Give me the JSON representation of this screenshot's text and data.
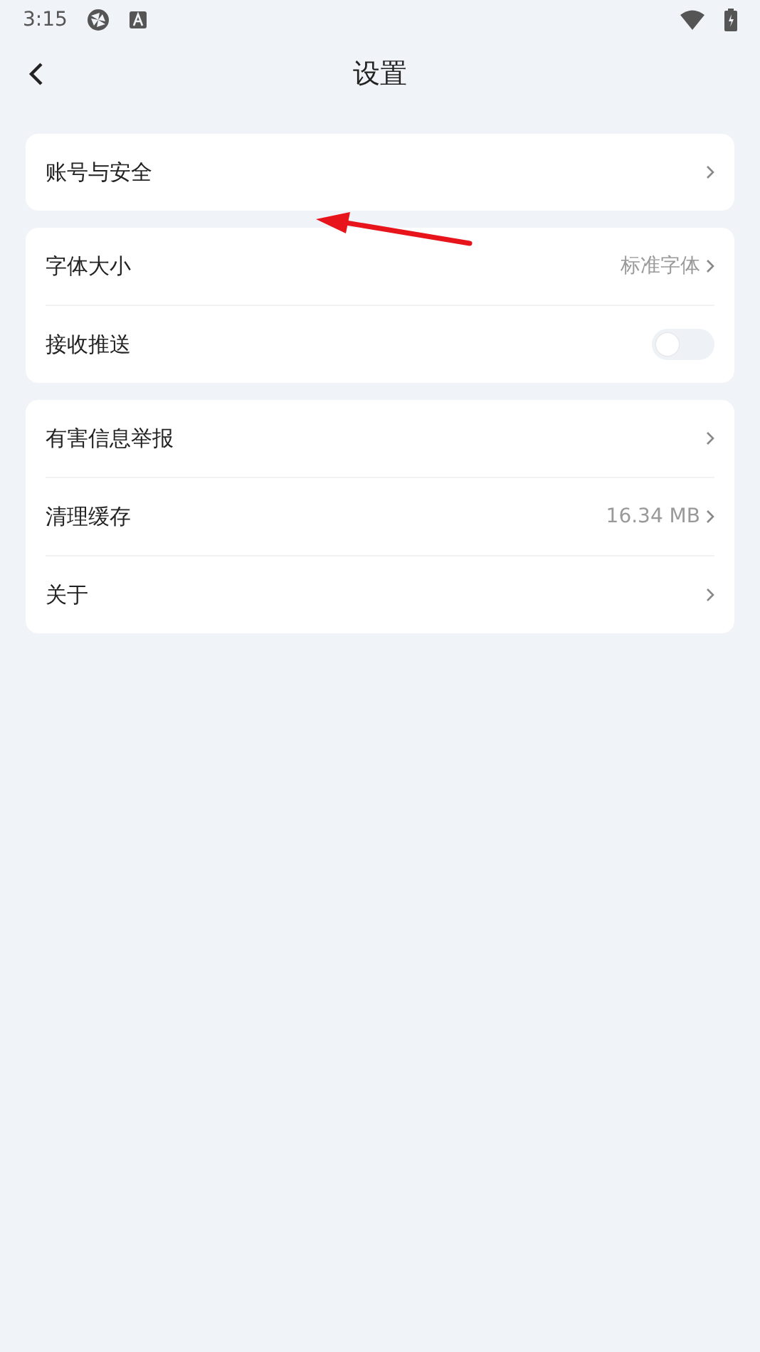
{
  "status_bar": {
    "time": "3:15"
  },
  "header": {
    "title": "设置"
  },
  "groups": [
    {
      "rows": [
        {
          "kind": "link",
          "label": "账号与安全"
        }
      ]
    },
    {
      "rows": [
        {
          "kind": "link",
          "label": "字体大小",
          "value": "标准字体"
        },
        {
          "kind": "toggle",
          "label": "接收推送",
          "on": false
        }
      ]
    },
    {
      "rows": [
        {
          "kind": "link",
          "label": "有害信息举报"
        },
        {
          "kind": "link",
          "label": "清理缓存",
          "value": "16.34 MB"
        },
        {
          "kind": "link",
          "label": "关于"
        }
      ]
    }
  ]
}
